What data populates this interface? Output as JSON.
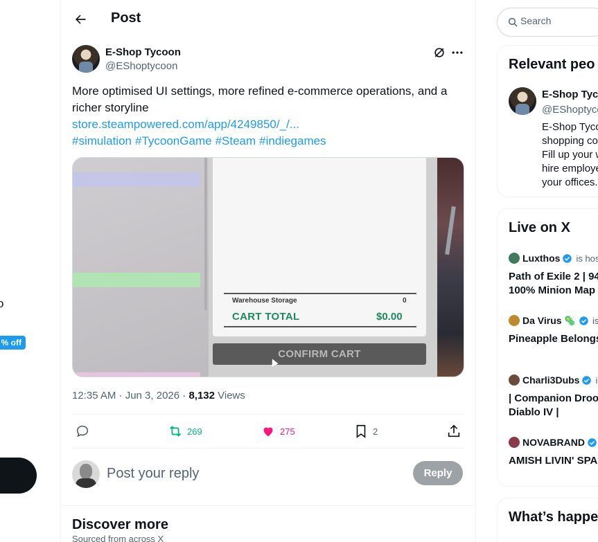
{
  "left_nav": {
    "clipped_text": "o",
    "discount_badge": "% off"
  },
  "header": {
    "title": "Post"
  },
  "post": {
    "author_name": "E-Shop Tycoon",
    "author_handle": "@EShoptycoon",
    "text": "More optimised UI settings, more refined e-commerce operations, and a richer storyline",
    "link": "store.steampowered.com/app/4249850/_/...",
    "hashtags": [
      "#simulation",
      "#TycoonGame",
      "#Steam",
      "#indiegames"
    ],
    "media": {
      "warehouse_label": "Warehouse Storage",
      "warehouse_value": "0",
      "cart_total_label": "CART TOTAL",
      "cart_total_value": "$0.00",
      "confirm_button": "CONFIRM CART"
    },
    "timestamp": "12:35 AM · Jun 3, 2026 · ",
    "views_count": "8,132",
    "views_label": " Views",
    "stats": {
      "reposts": "269",
      "likes": "275",
      "bookmarks": "2"
    }
  },
  "reply": {
    "placeholder": "Post your reply",
    "button_label": "Reply"
  },
  "discover": {
    "title": "Discover more",
    "subtitle": "Sourced from across X"
  },
  "search": {
    "placeholder": "Search"
  },
  "relevant_people": {
    "title": "Relevant peo",
    "name": "E-Shop Tyco",
    "handle": "@EShoptyco",
    "bio_lines": [
      "E-Shop Tyco",
      "shopping co",
      "Fill up your w",
      "hire employe",
      "your offices."
    ]
  },
  "live": {
    "title": "Live on X",
    "items": [
      {
        "host": "Luxthos",
        "status": "is host",
        "title_lines": [
          "Path of Exile 2 | 94",
          "100% Minion Map"
        ],
        "avatar_color": "#3f7a5a"
      },
      {
        "host": "Da Virus",
        "emoji": "🦠",
        "status": "is",
        "title_lines": [
          "Pineapple Belongs"
        ],
        "avatar_color": "#c08a2c"
      },
      {
        "host": "Charli3Dubs",
        "status": "is",
        "title_lines": [
          "| Companion Droo",
          "Diablo IV |"
        ],
        "avatar_color": "#6a4a3a"
      },
      {
        "host": "NOVABRAND",
        "status": "",
        "title_lines": [
          "AMISH LIVIN' SPA"
        ],
        "avatar_color": "#8a3a4a"
      }
    ]
  },
  "happening": {
    "title": "What’s happe"
  },
  "colors": {
    "accent": "#1d9bf0",
    "repost": "#00ba7c",
    "like": "#f91880",
    "secondary_text": "#536471"
  }
}
